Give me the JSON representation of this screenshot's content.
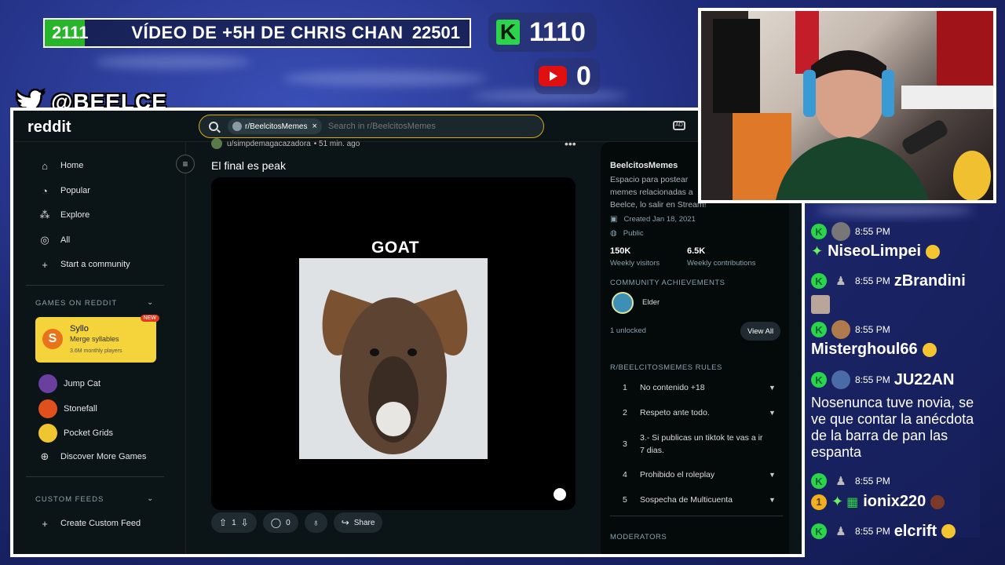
{
  "overlay": {
    "goal": {
      "current": "2111",
      "title": "VÍDEO DE +5H DE CHRIS CHAN",
      "target": "22501",
      "progress_fraction": 0.094
    },
    "kick_logo": "K",
    "kick_count": "1110",
    "youtube_count": "0",
    "twitter_handle": "@BEELCE_",
    "colors": {
      "kick_green": "#2bd44a",
      "youtube_red": "#e01010",
      "goal_fill": "#27b52a"
    }
  },
  "reddit": {
    "logo": "reddit",
    "search": {
      "chip": "r/BeelcitosMemes",
      "chip_close": "×",
      "placeholder": "Search in r/BeelcitosMemes"
    },
    "nav": [
      "Home",
      "Popular",
      "Explore",
      "All",
      "Start a community"
    ],
    "games_section": {
      "title": "GAMES ON REDDIT",
      "featured": {
        "name": "Syllo",
        "desc": "Merge syllables",
        "players": "3.6M monthly players",
        "badge": "NEW",
        "logo": "S"
      },
      "items": [
        "Jump Cat",
        "Stonefall",
        "Pocket Grids",
        "Discover More Games"
      ]
    },
    "custom_feeds": {
      "title": "CUSTOM FEEDS",
      "create": "Create Custom Feed"
    },
    "post": {
      "author": "u/simpdemagacazadora",
      "time": "• 51 min. ago",
      "more": "•••",
      "title": "El final es peak",
      "overlay_text": "GOAT",
      "votes": "1",
      "comments": "0",
      "share": "Share"
    },
    "sidebar": {
      "name": "BeelcitosMemes",
      "description": "Espacio para postear memes relacionadas a Beelce, lo salir en Stream!",
      "created": "Created Jan 18, 2021",
      "visibility": "Public",
      "stats": [
        {
          "value": "150K",
          "label": "Weekly visitors"
        },
        {
          "value": "6.5K",
          "label": "Weekly contributions"
        }
      ],
      "achievements_title": "COMMUNITY ACHIEVEMENTS",
      "achievement": "Elder",
      "unlocked": "1 unlocked",
      "view_all": "View All",
      "rules_title": "R/BEELCITOSMEMES RULES",
      "rules": [
        {
          "num": "1",
          "text": "No contenido +18"
        },
        {
          "num": "2",
          "text": "Respeto ante todo."
        },
        {
          "num": "3",
          "text": "3.- Si publicas un tiktok te vas a ir 7 dias."
        },
        {
          "num": "4",
          "text": "Prohibido el roleplay"
        },
        {
          "num": "5",
          "text": "Sospecha de Multicuenta"
        }
      ],
      "moderators_title": "MODERATORS"
    }
  },
  "chat": [
    {
      "time": "8:55 PM",
      "name": "NiseoLimpei",
      "message": ""
    },
    {
      "time": "8:55 PM",
      "name": "zBrandini",
      "message": ""
    },
    {
      "time": "8:55 PM",
      "name": "Misterghoul66",
      "message": ""
    },
    {
      "time": "8:55 PM",
      "name": "JU22AN",
      "message": "Nosenunca tuve novia, se ve que contar la anécdota de la barra de pan las espanta"
    },
    {
      "time": "8:55 PM",
      "name": "ionix220",
      "message": "",
      "badge": "1"
    },
    {
      "time": "8:55 PM",
      "name": "elcrift",
      "message": ""
    }
  ]
}
